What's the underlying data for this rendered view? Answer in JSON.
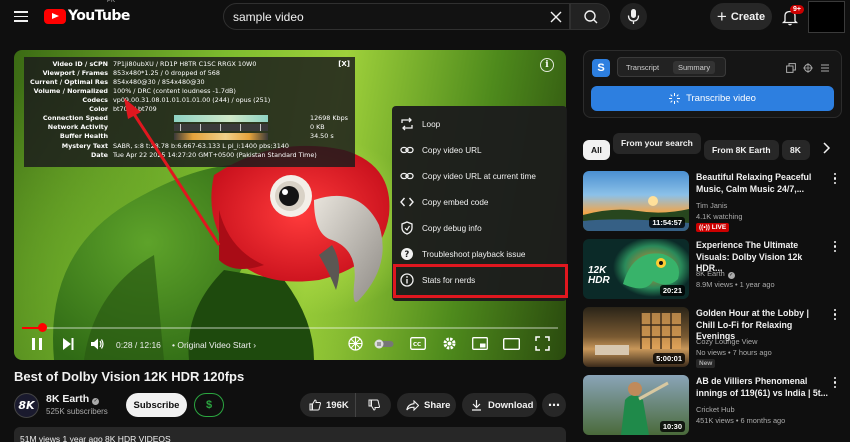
{
  "header": {
    "logo_text": "YouTube",
    "logo_region": "PK",
    "search_value": "sample video",
    "create_label": "Create",
    "notifications_badge": "9+"
  },
  "player": {
    "stats": {
      "close_label": "[X]",
      "rows": [
        {
          "key": "Video ID / sCPN",
          "value": "7P1ji80ubXU / RD1P H8TR C1SC RRGX 10W0"
        },
        {
          "key": "Viewport / Frames",
          "value": "853x480*1.25 / 0 dropped of 568"
        },
        {
          "key": "Current / Optimal Res",
          "value": "854x480@30 / 854x480@30"
        },
        {
          "key": "Volume / Normalized",
          "value": "100% / DRC (content loudness -1.7dB)"
        },
        {
          "key": "Codecs",
          "value": "vp09.00.31.08.01.01.01.01.00 (244) / opus (251)"
        },
        {
          "key": "Color",
          "value": "bt709 / bt709"
        },
        {
          "key": "Connection Speed",
          "value": "12698 Kbps"
        },
        {
          "key": "Network Activity",
          "value": "0 KB"
        },
        {
          "key": "Buffer Health",
          "value": "34.50 s"
        },
        {
          "key": "Mystery Text",
          "value": "SABR, s:8 t:28.78 b:6.667-63.133 L pl_i:1400 pbs:3140"
        },
        {
          "key": "Date",
          "value": "Tue Apr 22 2025 14:27:20 GMT+0500 (Pakistan Standard Time)"
        }
      ]
    },
    "context_menu": [
      {
        "label": "Loop",
        "icon": "loop-icon"
      },
      {
        "label": "Copy video URL",
        "icon": "link-icon"
      },
      {
        "label": "Copy video URL at current time",
        "icon": "link-icon"
      },
      {
        "label": "Copy embed code",
        "icon": "embed-code-icon"
      },
      {
        "label": "Copy debug info",
        "icon": "debug-icon"
      },
      {
        "label": "Troubleshoot playback issue",
        "icon": "help-icon"
      },
      {
        "label": "Stats for nerds",
        "icon": "info-icon"
      }
    ],
    "time_display": "0:28 / 12:16",
    "chapter_label": "• Original Video Start",
    "progress_fraction": 0.038
  },
  "video": {
    "title": "Best of Dolby Vision 12K HDR 120fps",
    "channel_name": "8K Earth",
    "channel_avatar_text": "8K",
    "subscribers": "525K subscribers",
    "subscribe_label": "Subscribe",
    "thanks_label": "$",
    "likes": "196K",
    "share_label": "Share",
    "download_label": "Download",
    "meta_line": "51M views  1 year ago  8K HDR VIDEOS"
  },
  "extension": {
    "logo_text": "S",
    "tab_transcript": "Transcript",
    "tab_summary": "Summary",
    "transcribe_label": "Transcribe video"
  },
  "chips": [
    "All",
    "From your search",
    "From 8K Earth",
    "8K"
  ],
  "recommendations": [
    {
      "title": "Beautiful Relaxing Peaceful Music, Calm Music 24/7,...",
      "channel": "Tim Janis",
      "meta": "4.1K watching",
      "badge": "LIVE",
      "duration": "11:54:57"
    },
    {
      "title": "Experience The Ultimate Visuals: Dolby Vision 12k HDR...",
      "channel": "8K Earth",
      "meta": "8.9M views • 1 year ago",
      "badge": "",
      "duration": "20:21",
      "thumb_text": "12K HDR"
    },
    {
      "title": "Golden Hour at the Lobby | Chill Lo-Fi for Relaxing Evenings",
      "channel": "Cozy Lounge View",
      "meta": "No views • 7 hours ago",
      "badge": "New",
      "duration": "5:00:01"
    },
    {
      "title": "AB de Villiers Phenomenal innings of 119(61) vs India | 5t...",
      "channel": "Cricket Hub",
      "meta": "451K views • 6 months ago",
      "badge": "",
      "duration": "10:30"
    }
  ],
  "colors": {
    "accent_red": "#ff0000",
    "highlight_box": "#e0171f",
    "extension_blue": "#2d7fe0",
    "background": "#0f0f0f"
  }
}
